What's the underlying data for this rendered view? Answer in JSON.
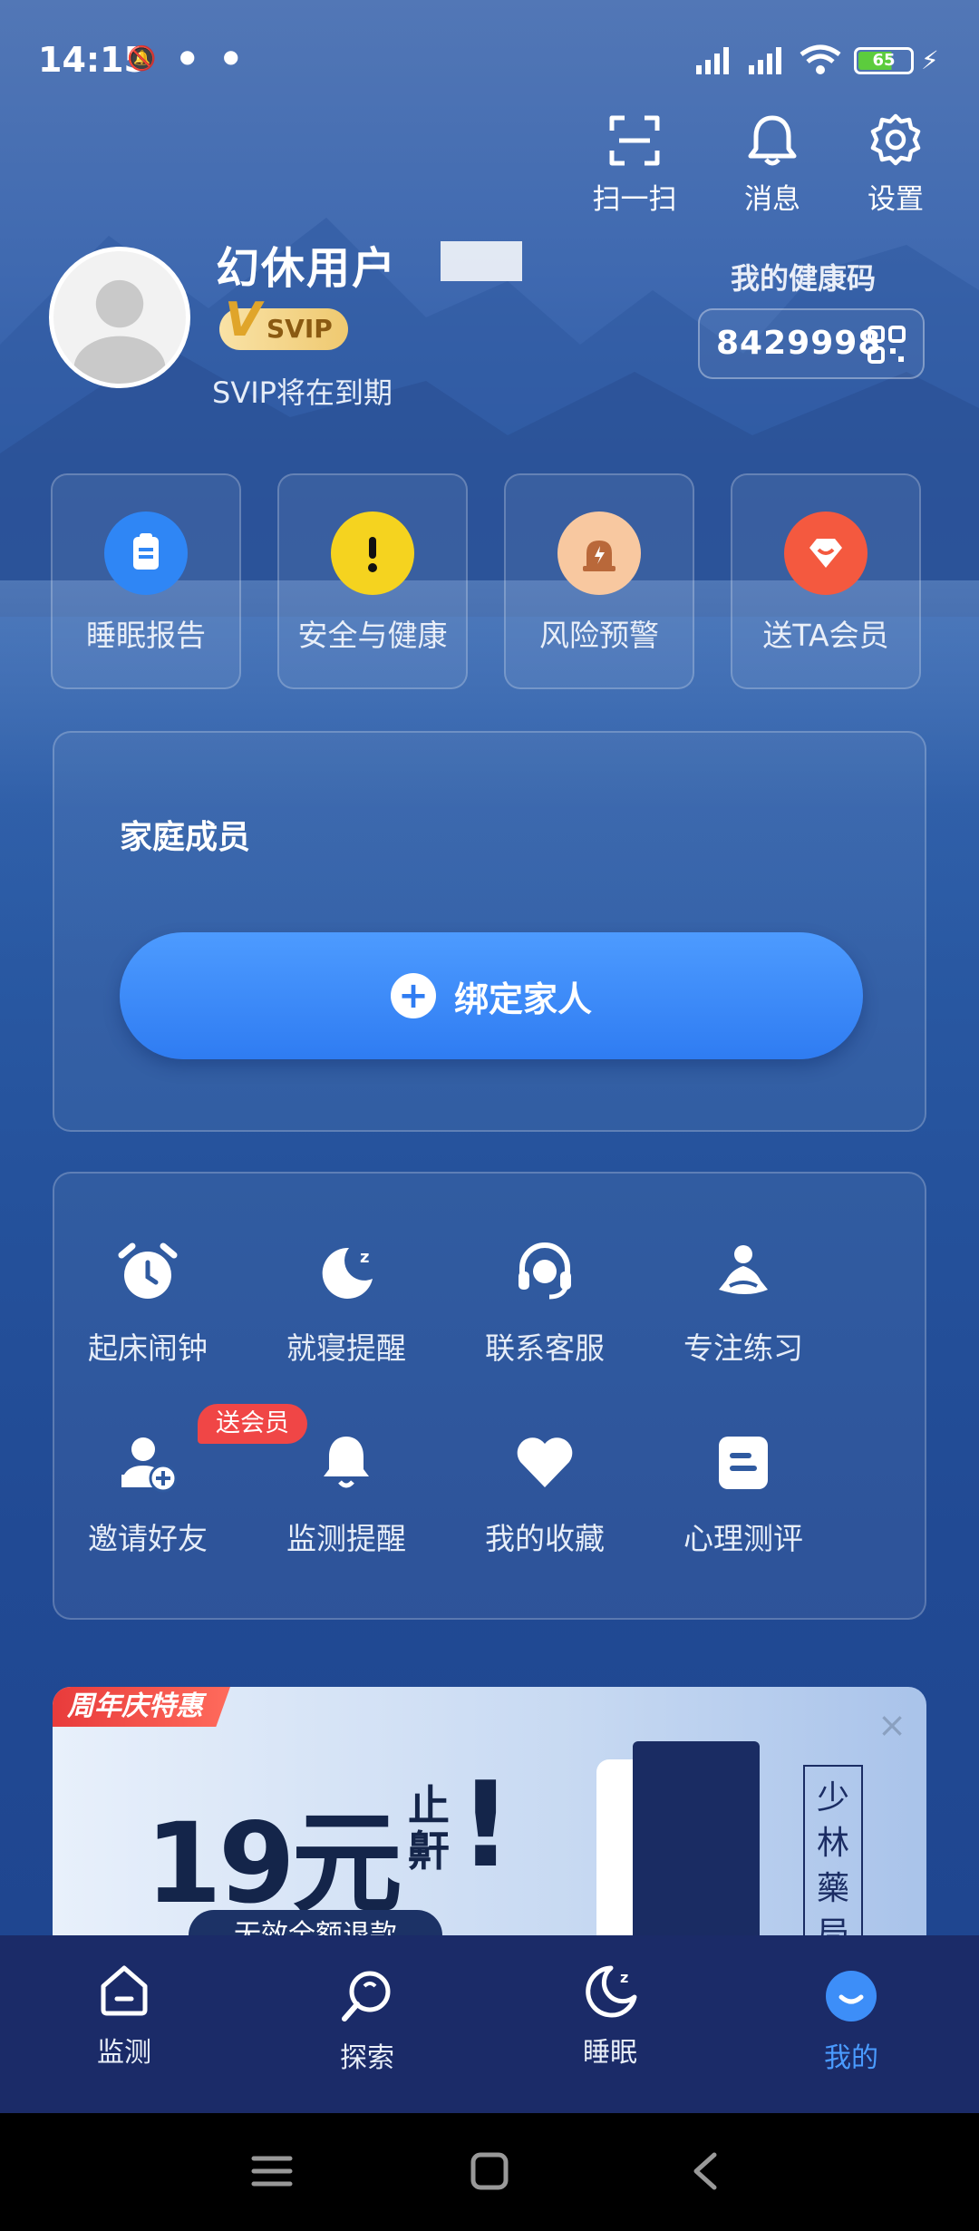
{
  "status_bar": {
    "time": "14:15",
    "battery_level": "65"
  },
  "top_actions": [
    {
      "label": "扫一扫",
      "icon": "scan-icon"
    },
    {
      "label": "消息",
      "icon": "bell-icon"
    },
    {
      "label": "设置",
      "icon": "gear-icon"
    }
  ],
  "profile": {
    "username": "幻休用户",
    "vip_badge": "SVIP",
    "vip_note": "SVIP将在到期",
    "health_code_title": "我的健康码",
    "health_code": "8429998"
  },
  "quick_tiles": [
    {
      "label": "睡眠报告",
      "icon": "report-icon",
      "color": "#2f86f5"
    },
    {
      "label": "安全与健康",
      "icon": "exclamation-icon",
      "color": "#f5d31f"
    },
    {
      "label": "风险预警",
      "icon": "alarm-light-icon",
      "color": "#f8c8a0"
    },
    {
      "label": "送TA会员",
      "icon": "diamond-gift-icon",
      "color": "#f4593f"
    }
  ],
  "family": {
    "title": "家庭成员",
    "bind_button": "绑定家人"
  },
  "tools": [
    {
      "label": "起床闹钟",
      "icon": "alarm-clock-icon"
    },
    {
      "label": "就寝提醒",
      "icon": "moon-sleep-icon"
    },
    {
      "label": "联系客服",
      "icon": "headset-icon"
    },
    {
      "label": "专注练习",
      "icon": "meditation-icon"
    },
    {
      "label": "邀请好友",
      "icon": "add-user-icon"
    },
    {
      "label": "监测提醒",
      "icon": "bell-icon"
    },
    {
      "label": "我的收藏",
      "icon": "heart-icon"
    },
    {
      "label": "心理测评",
      "icon": "assessment-icon"
    }
  ],
  "gift_tag": "送会员",
  "promo": {
    "tag": "周年庆特惠",
    "price": "19元",
    "product_word": "止鼾",
    "bang": "!",
    "subtitle": "无效全额退款",
    "brand": "少林藥局"
  },
  "bottom_nav": [
    {
      "label": "监测",
      "icon": "home-icon",
      "active": false
    },
    {
      "label": "探索",
      "icon": "explore-icon",
      "active": false
    },
    {
      "label": "睡眠",
      "icon": "moon-icon",
      "active": false
    },
    {
      "label": "我的",
      "icon": "smile-icon",
      "active": true
    }
  ],
  "colors": {
    "accent": "#2f7cf2",
    "active_nav": "#4a9bff",
    "gift_tag": "#f04646"
  }
}
